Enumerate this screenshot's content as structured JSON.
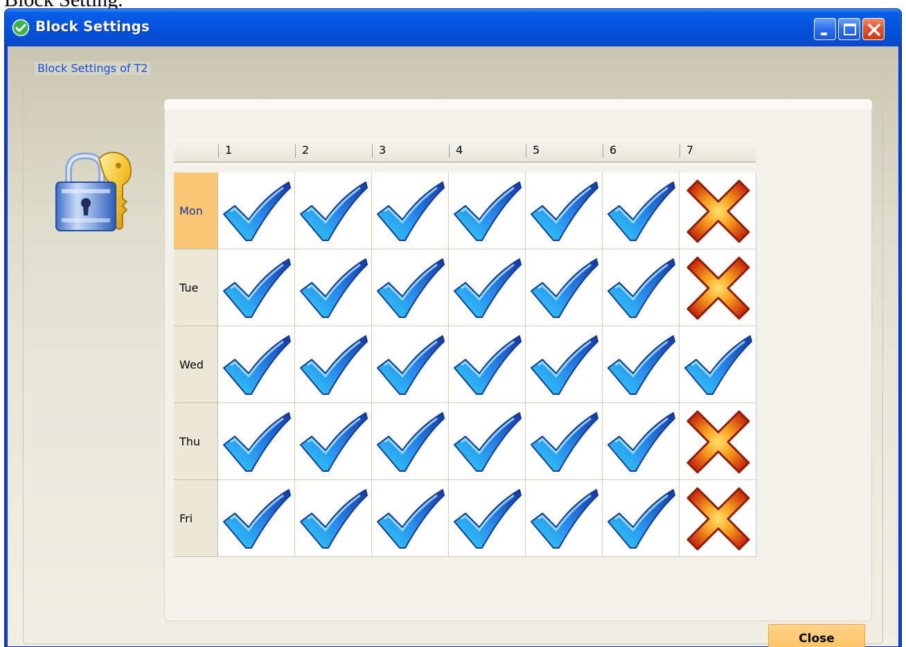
{
  "document": {
    "caption": "Block Setting."
  },
  "window": {
    "title": "Block Settings",
    "controls": {
      "minimize_icon": "minimize-icon",
      "maximize_icon": "maximize-icon",
      "close_icon": "close-icon"
    }
  },
  "group": {
    "legend": "Block Settings of T2",
    "icon": "lock-and-key-icon"
  },
  "grid": {
    "columns": [
      "1",
      "2",
      "3",
      "4",
      "5",
      "6",
      "7"
    ],
    "rows": [
      {
        "day": "Mon",
        "selected": true,
        "cells": [
          "allowed",
          "allowed",
          "allowed",
          "allowed",
          "allowed",
          "allowed",
          "blocked"
        ]
      },
      {
        "day": "Tue",
        "selected": false,
        "cells": [
          "allowed",
          "allowed",
          "allowed",
          "allowed",
          "allowed",
          "allowed",
          "blocked"
        ]
      },
      {
        "day": "Wed",
        "selected": false,
        "cells": [
          "allowed",
          "allowed",
          "allowed",
          "allowed",
          "allowed",
          "allowed",
          "allowed"
        ]
      },
      {
        "day": "Thu",
        "selected": false,
        "cells": [
          "allowed",
          "allowed",
          "allowed",
          "allowed",
          "allowed",
          "allowed",
          "blocked"
        ]
      },
      {
        "day": "Fri",
        "selected": false,
        "cells": [
          "allowed",
          "allowed",
          "allowed",
          "allowed",
          "allowed",
          "allowed",
          "blocked"
        ]
      }
    ],
    "cell_icons": {
      "allowed": "blue-check-icon",
      "blocked": "red-x-icon"
    }
  },
  "buttons": {
    "close_label": "Close"
  },
  "colors": {
    "titlebar": "#0553e0",
    "legend_text": "#1650d8",
    "selected_row": "#f9c877",
    "button": "#fbc15e"
  }
}
